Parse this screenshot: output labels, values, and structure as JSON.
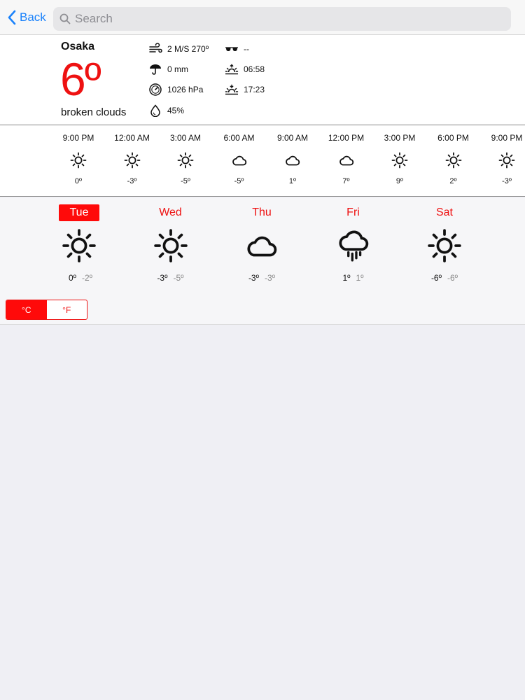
{
  "nav": {
    "back_label": "Back",
    "search_placeholder": "Search"
  },
  "current": {
    "city": "Osaka",
    "temp": "6º",
    "description": "broken clouds",
    "wind": "2 M/S 270º",
    "rain": "0 mm",
    "pressure": "1026 hPa",
    "humidity": "45%",
    "visibility": "--",
    "sunrise": "06:58",
    "sunset": "17:23"
  },
  "hourly": [
    {
      "time": "9:00 PM",
      "icon": "sun-icon",
      "temp": "0º"
    },
    {
      "time": "12:00 AM",
      "icon": "sun-icon",
      "temp": "-3º"
    },
    {
      "time": "3:00 AM",
      "icon": "sun-icon",
      "temp": "-5º"
    },
    {
      "time": "6:00 AM",
      "icon": "cloud-icon",
      "temp": "-5º"
    },
    {
      "time": "9:00 AM",
      "icon": "cloud-icon",
      "temp": "1º"
    },
    {
      "time": "12:00 PM",
      "icon": "cloud-icon",
      "temp": "7º"
    },
    {
      "time": "3:00 PM",
      "icon": "sun-icon",
      "temp": "9º"
    },
    {
      "time": "6:00 PM",
      "icon": "sun-icon",
      "temp": "2º"
    },
    {
      "time": "9:00 PM",
      "icon": "sun-icon",
      "temp": "-3º"
    }
  ],
  "daily": [
    {
      "day": "Tue",
      "icon": "sun-icon",
      "high": "0º",
      "low": "-2º",
      "selected": true
    },
    {
      "day": "Wed",
      "icon": "sun-icon",
      "high": "-3º",
      "low": "-5º",
      "selected": false
    },
    {
      "day": "Thu",
      "icon": "cloud-icon",
      "high": "-3º",
      "low": "-3º",
      "selected": false
    },
    {
      "day": "Fri",
      "icon": "rain-cloud-icon",
      "high": "1º",
      "low": "1º",
      "selected": false
    },
    {
      "day": "Sat",
      "icon": "sun-icon",
      "high": "-6º",
      "low": "-6º",
      "selected": false
    }
  ],
  "units": {
    "celsius": "°C",
    "fahrenheit": "°F",
    "selected": "celsius"
  },
  "colors": {
    "accent": "#ee1111",
    "link": "#1a82fb"
  }
}
